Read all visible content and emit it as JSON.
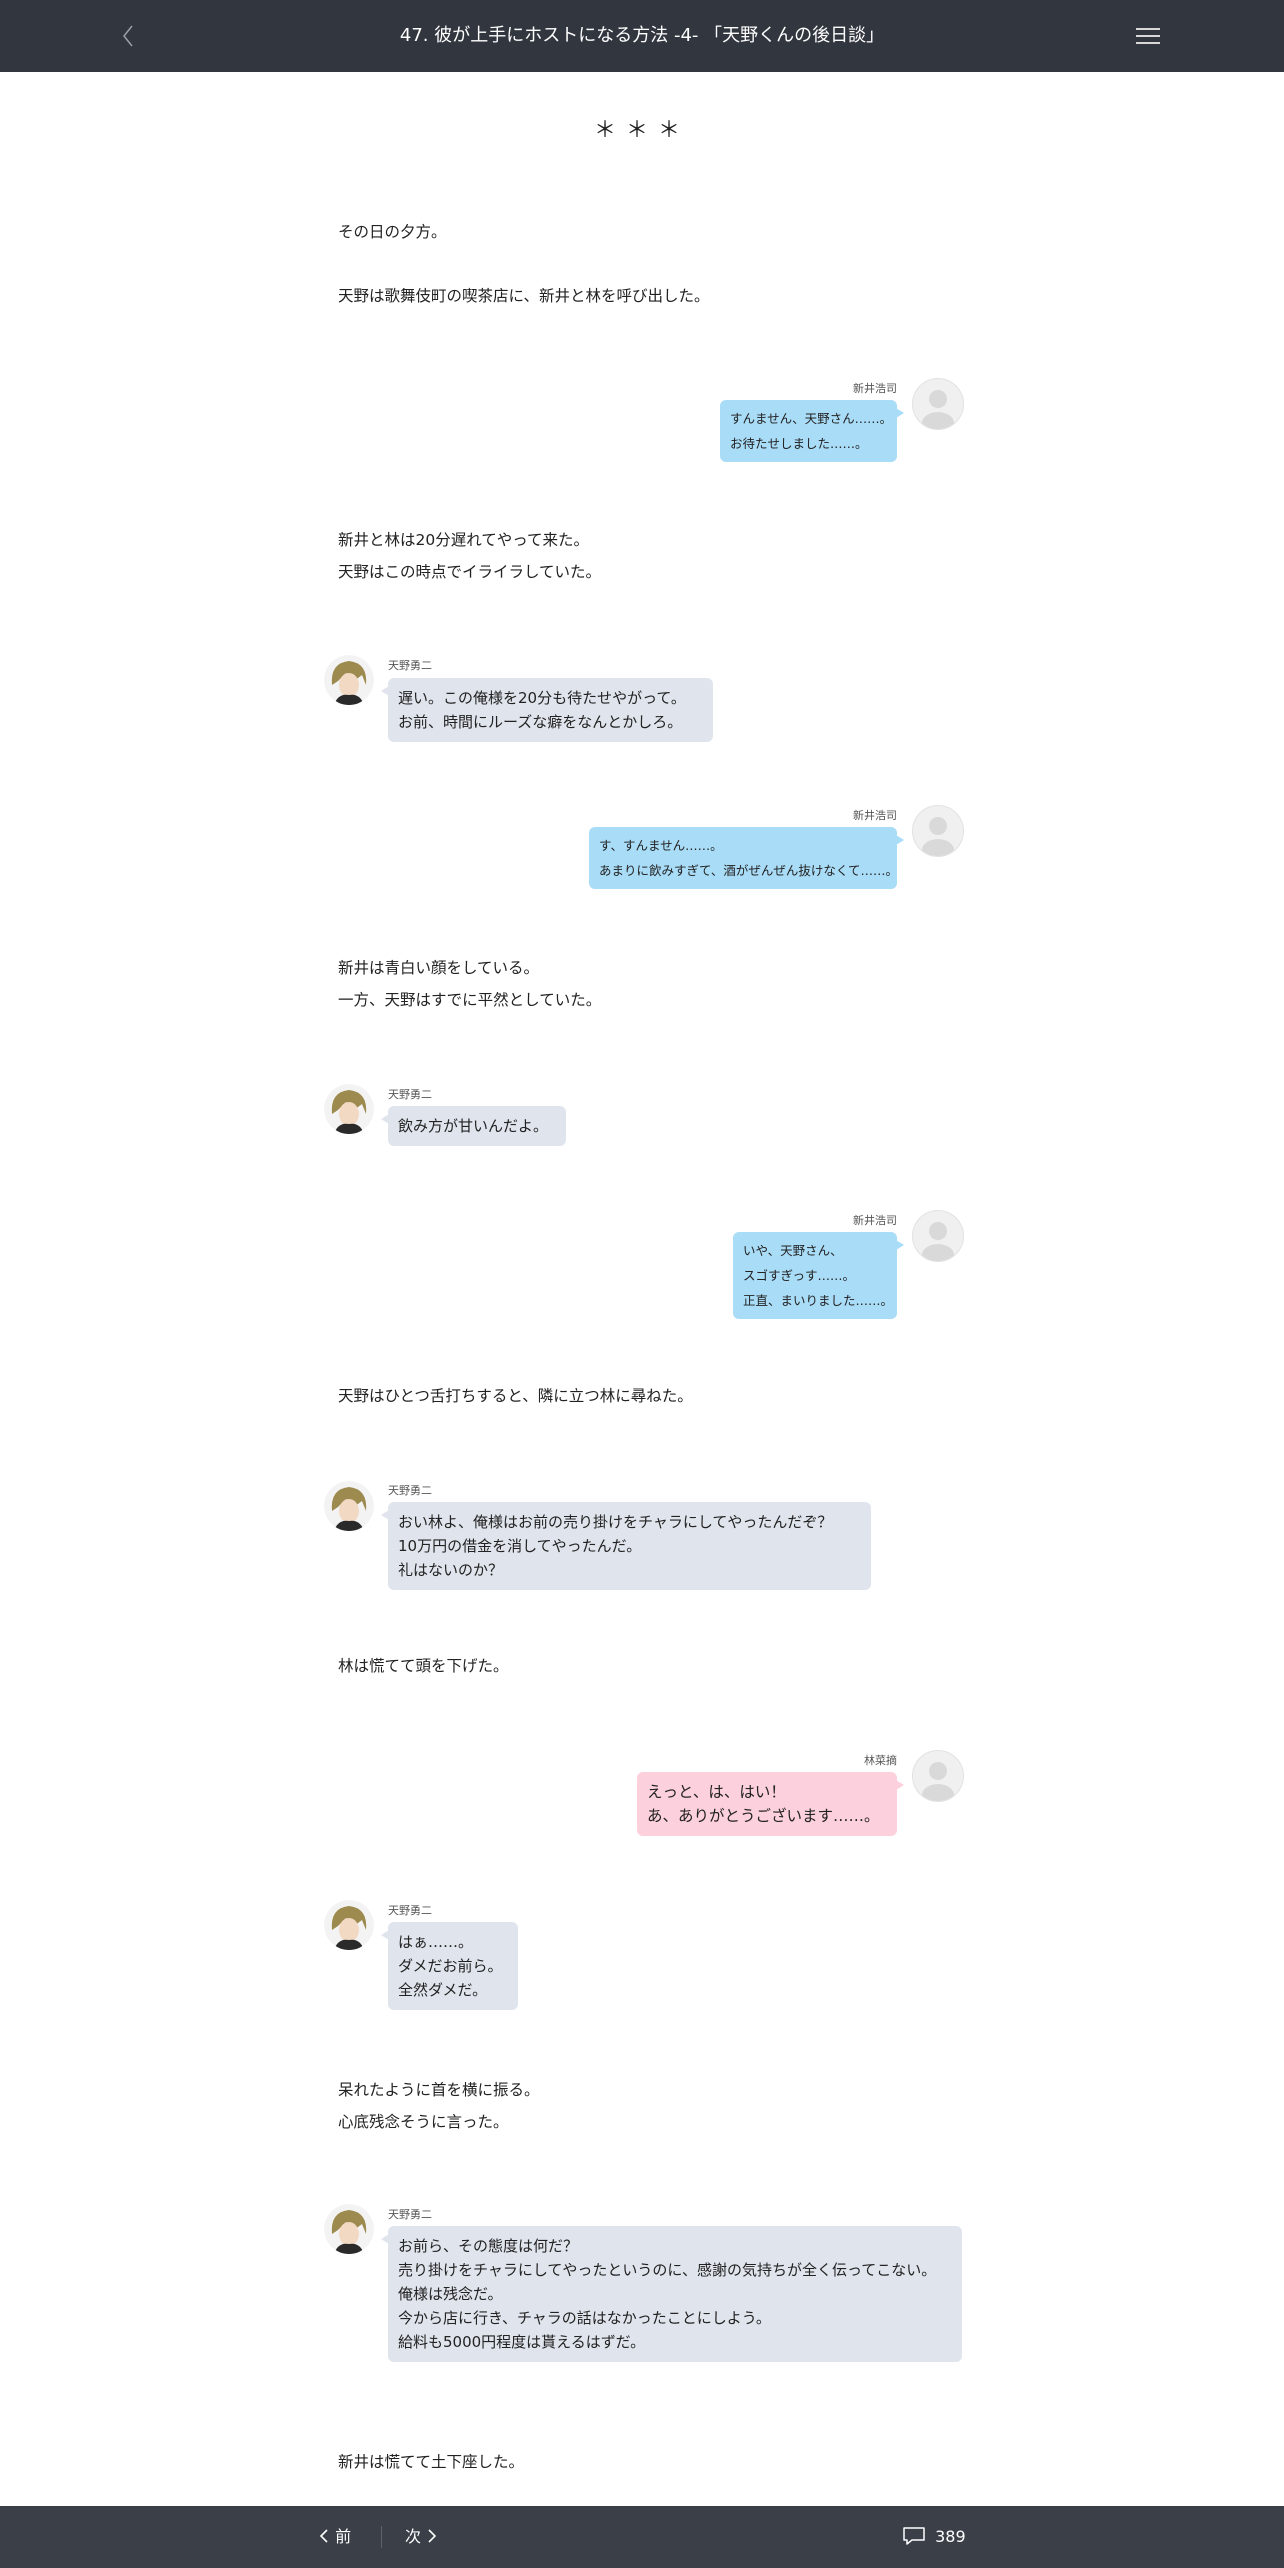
{
  "header": {
    "title": "47. 彼が上手にホストになる方法 -4- 「天野くんの後日談」",
    "back_icon": "chevron-left-icon",
    "menu_icon": "hamburger-menu-icon"
  },
  "divider": "＊＊＊",
  "narration": [
    [
      "その日の夕方。"
    ],
    [
      "天野は歌舞伎町の喫茶店に、新井と林を呼び出した。"
    ],
    [
      "新井と林は20分遅れてやって来た。",
      "天野はこの時点でイライラしていた。"
    ],
    [
      "新井は青白い顔をしている。",
      "一方、天野はすでに平然としていた。"
    ],
    [
      "天野はひとつ舌打ちすると、隣に立つ林に尋ねた。"
    ],
    [
      "林は慌てて頭を下げた。"
    ],
    [
      "呆れたように首を横に振る。",
      "心底残念そうに言った。"
    ],
    [
      "新井は慌てて土下座した。"
    ]
  ],
  "messages": [
    {
      "speaker": "新井浩司",
      "lines": [
        "すんません、天野さん……。",
        "お待たせしました……。"
      ]
    },
    {
      "speaker": "天野勇二",
      "lines": [
        "遅い。この俺様を20分も待たせやがって。",
        "お前、時間にルーズな癖をなんとかしろ。"
      ]
    },
    {
      "speaker": "新井浩司",
      "lines": [
        "す、すんません……。",
        "あまりに飲みすぎて、酒がぜんぜん抜けなくて……。"
      ]
    },
    {
      "speaker": "天野勇二",
      "lines": [
        "飲み方が甘いんだよ。"
      ]
    },
    {
      "speaker": "新井浩司",
      "lines": [
        "いや、天野さん、",
        "スゴすぎっす……。",
        "正直、まいりました……。"
      ]
    },
    {
      "speaker": "天野勇二",
      "lines": [
        "おい林よ、俺様はお前の売り掛けをチャラにしてやったんだぞ？",
        "10万円の借金を消してやったんだ。",
        "礼はないのか？"
      ]
    },
    {
      "speaker": "林菜摘",
      "lines": [
        "えっと、は、はい！",
        "あ、ありがとうございます……。"
      ]
    },
    {
      "speaker": "天野勇二",
      "lines": [
        "はぁ……。",
        "ダメだお前ら。",
        "全然ダメだ。"
      ]
    },
    {
      "speaker": "天野勇二",
      "lines": [
        "お前ら、その態度は何だ？",
        "売り掛けをチャラにしてやったというのに、感謝の気持ちが全く伝ってこない。",
        "俺様は残念だ。",
        "今から店に行き、チャラの話はなかったことにしよう。",
        "給料も5000円程度は貰えるはずだ。"
      ]
    }
  ],
  "footer": {
    "prev_label": "前",
    "next_label": "次",
    "comment_count": "389",
    "prev_icon": "chevron-left-icon",
    "next_icon": "chevron-right-icon",
    "comment_icon": "comment-icon"
  },
  "colors": {
    "header_bg": "#31363f",
    "footer_bg": "#3a3f48",
    "bubble_blue": "#a9dcf7",
    "bubble_pink": "#fcd0dc",
    "bubble_gray": "#e0e5ed"
  }
}
